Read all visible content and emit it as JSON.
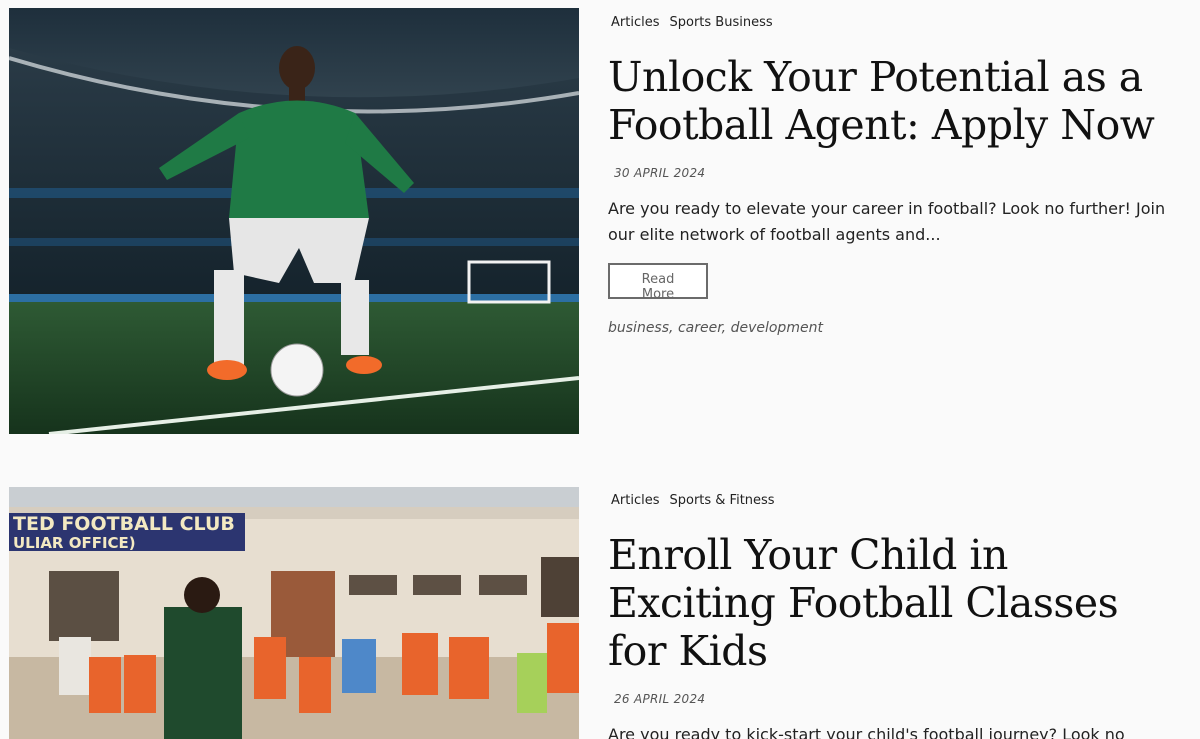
{
  "posts": [
    {
      "categories": [
        "Articles",
        "Sports Business"
      ],
      "title": "Unlock Your Potential as a Football Agent: Apply Now",
      "date": "30 APRIL 2024",
      "excerpt": "Are you ready to elevate your career in football? Look no further! Join our elite network of football agents and...",
      "read_more": "Read More",
      "tags": [
        "business",
        "career",
        "development"
      ],
      "tag_separator": ","
    },
    {
      "categories": [
        "Articles",
        "Sports & Fitness"
      ],
      "title": "Enroll Your Child in Exciting Football Classes for Kids",
      "date": "26 APRIL 2024",
      "excerpt": "Are you ready to kick-start your child's football journey? Look no further than our specialized classes designed specifically for kids!...",
      "banner_text_1": "TED FOOTBALL CLUB",
      "banner_text_2": "ULIAR OFFICE)"
    }
  ]
}
